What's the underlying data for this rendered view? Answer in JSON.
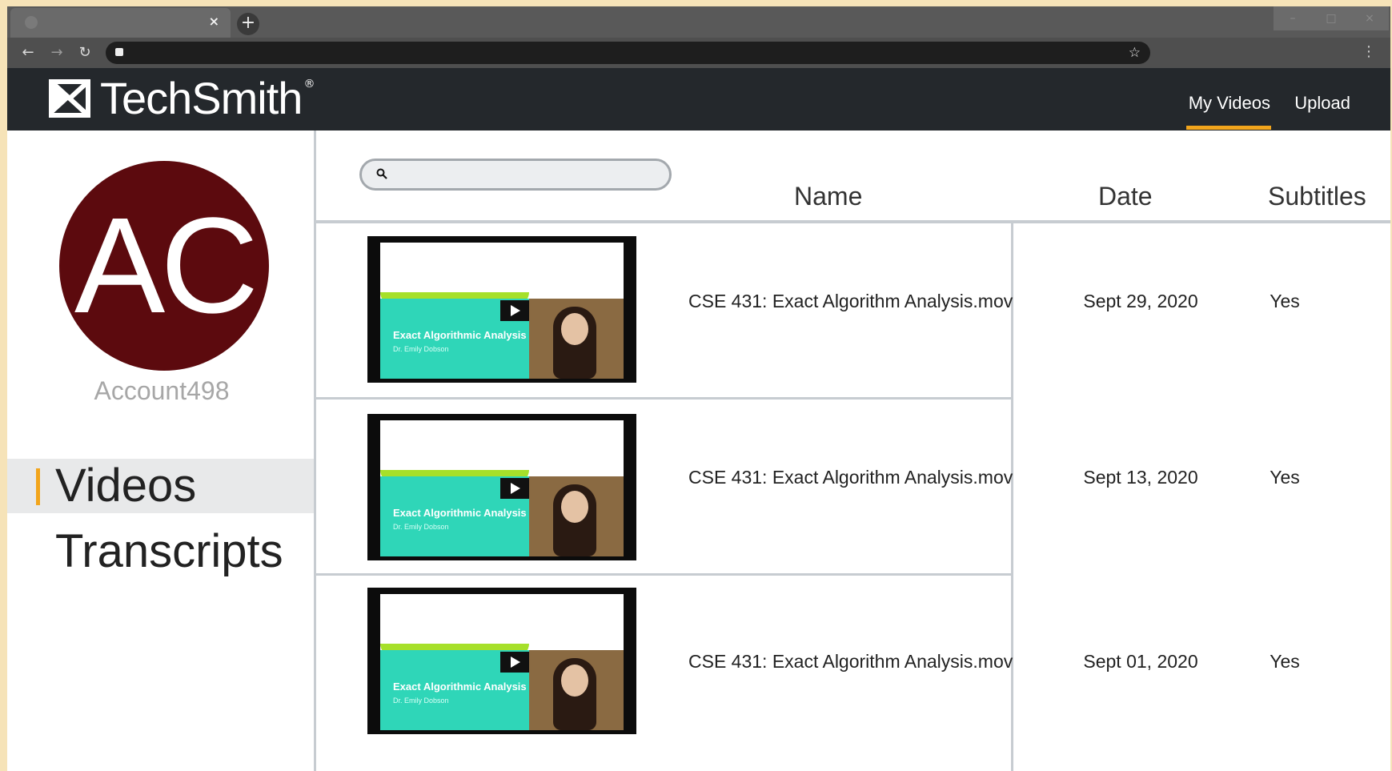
{
  "browser": {
    "tab_close_glyph": "×",
    "new_tab_glyph": "+",
    "back_glyph": "←",
    "forward_glyph": "→",
    "reload_glyph": "↻",
    "star_glyph": "☆",
    "menu_glyph": "⋮"
  },
  "header": {
    "brand": "TechSmith",
    "brand_mark": "®",
    "nav": {
      "my_videos": "My Videos",
      "upload": "Upload"
    },
    "accent_color": "#f2a51c"
  },
  "sidebar": {
    "avatar_initials": "AC",
    "avatar_color": "#5c0a0e",
    "account_name": "Account498",
    "items": [
      {
        "label": "Videos",
        "active": true
      },
      {
        "label": "Transcripts",
        "active": false
      }
    ]
  },
  "search": {
    "placeholder": ""
  },
  "table": {
    "columns": {
      "name": "Name",
      "date": "Date",
      "subtitles": "Subtitles"
    },
    "rows": [
      {
        "name": "CSE 431: Exact Algorithm Analysis.mov",
        "date": "Sept 29, 2020",
        "subtitles": "Yes",
        "thumb_title": "Exact Algorithmic Analysis",
        "thumb_sub": "Dr. Emily Dobson"
      },
      {
        "name": "CSE 431: Exact Algorithm Analysis.mov",
        "date": "Sept 13, 2020",
        "subtitles": "Yes",
        "thumb_title": "Exact Algorithmic Analysis",
        "thumb_sub": "Dr. Emily Dobson"
      },
      {
        "name": "CSE 431: Exact Algorithm Analysis.mov",
        "date": "Sept 01, 2020",
        "subtitles": "Yes",
        "thumb_title": "Exact Algorithmic Analysis",
        "thumb_sub": "Dr. Emily Dobson"
      }
    ]
  }
}
